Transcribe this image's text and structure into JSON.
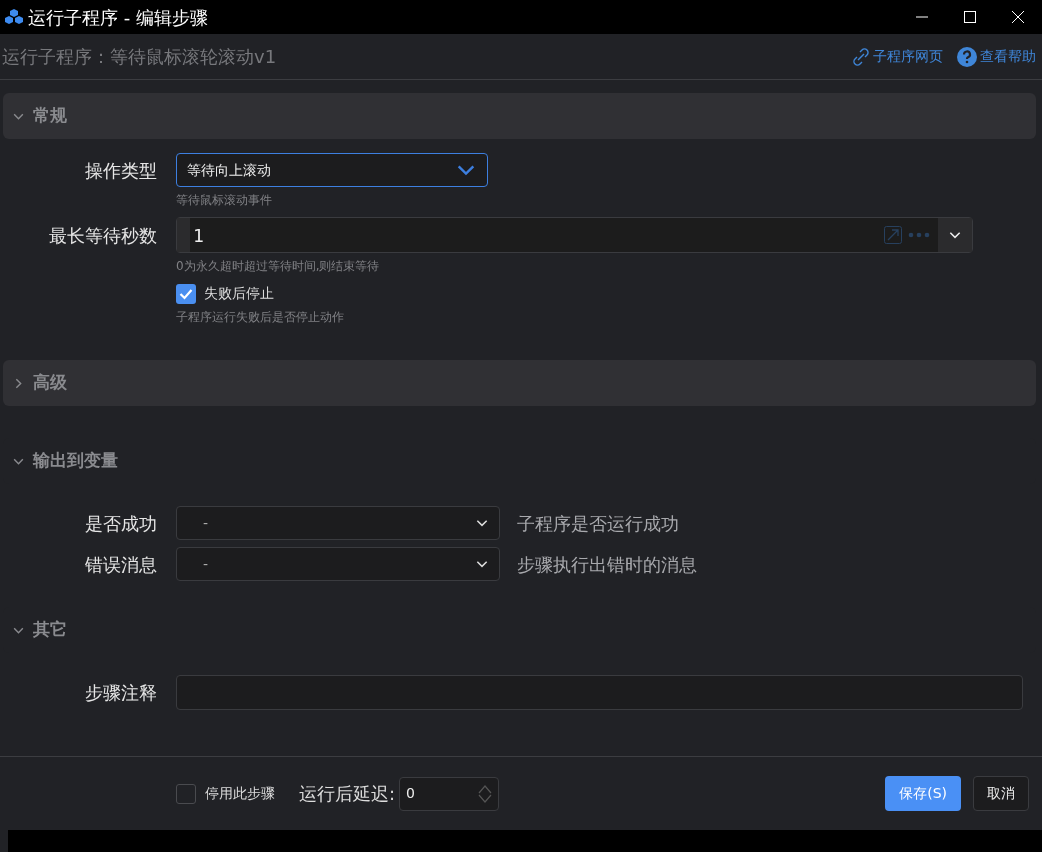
{
  "window": {
    "title": "运行子程序 - 编辑步骤"
  },
  "header": {
    "title": "运行子程序：等待鼠标滚轮滚动v1",
    "links": [
      {
        "label": "子程序网页",
        "kind": "link"
      },
      {
        "label": "查看帮助",
        "kind": "help"
      }
    ]
  },
  "sections": [
    {
      "title": "常规",
      "expanded": true,
      "shaded": true,
      "fields": [
        {
          "kind": "select",
          "label": "操作类型",
          "value": "等待向上滚动",
          "hint": "等待鼠标滚动事件"
        },
        {
          "kind": "number",
          "label": "最长等待秒数",
          "value": "1",
          "hint": "0为永久超时超过等待时间,则结束等待"
        },
        {
          "kind": "checkbox",
          "label": "失败后停止",
          "checked": true,
          "hint": "子程序运行失败后是否停止动作"
        }
      ]
    },
    {
      "title": "高级",
      "expanded": false,
      "shaded": true
    },
    {
      "title": "输出到变量",
      "expanded": true,
      "shaded": false,
      "fields": [
        {
          "kind": "output",
          "label": "是否成功",
          "value": "-",
          "description": "子程序是否运行成功"
        },
        {
          "kind": "output",
          "label": "错误消息",
          "value": "-",
          "description": "步骤执行出错时的消息"
        }
      ]
    },
    {
      "title": "其它",
      "expanded": true,
      "shaded": false,
      "fields": [
        {
          "kind": "text",
          "label": "步骤注释"
        }
      ]
    }
  ],
  "footer": {
    "disable": {
      "label": "停用此步骤",
      "checked": false
    },
    "delay": {
      "label": "运行后延迟:",
      "value": "0"
    },
    "buttons": [
      {
        "label": "保存(S)",
        "kind": "primary"
      },
      {
        "label": "取消",
        "kind": "secondary"
      }
    ]
  }
}
